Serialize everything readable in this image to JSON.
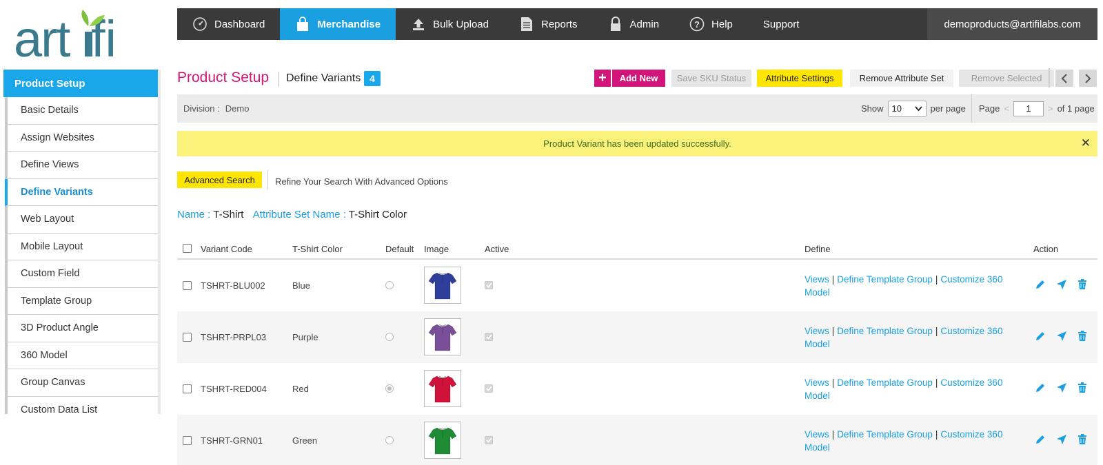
{
  "brand": {
    "logo_text": "artifi",
    "accent": "#1aa7ea",
    "primary_pink": "#d2157a",
    "yellow": "#ffe500"
  },
  "topnav": {
    "items": [
      {
        "label": "Dashboard",
        "icon": "gauge-icon"
      },
      {
        "label": "Merchandise",
        "icon": "shopping-bag-icon",
        "active": true
      },
      {
        "label": "Bulk Upload",
        "icon": "upload-icon"
      },
      {
        "label": "Reports",
        "icon": "document-icon"
      },
      {
        "label": "Admin",
        "icon": "lock-icon"
      },
      {
        "label": "Help",
        "icon": "question-icon"
      },
      {
        "label": "Support",
        "icon": ""
      }
    ],
    "user": "demoproducts@artifilabs.com"
  },
  "sidebar": {
    "header": "Product Setup",
    "items": [
      {
        "label": "Basic Details"
      },
      {
        "label": "Assign Websites"
      },
      {
        "label": "Define Views"
      },
      {
        "label": "Define Variants",
        "active": true
      },
      {
        "label": "Web Layout"
      },
      {
        "label": "Mobile Layout"
      },
      {
        "label": "Custom Field"
      },
      {
        "label": "Template Group"
      },
      {
        "label": "3D Product Angle"
      },
      {
        "label": "360 Model"
      },
      {
        "label": "Group Canvas"
      },
      {
        "label": "Custom Data List"
      }
    ]
  },
  "header": {
    "title": "Product Setup",
    "subtitle": "Define Variants",
    "count": "4",
    "buttons": {
      "add_new": "Add New",
      "save_sku": "Save SKU Status",
      "attr_settings": "Attribute Settings",
      "remove_set": "Remove Attribute Set",
      "remove_selected": "Remove Selected"
    }
  },
  "divbar": {
    "division_label": "Division :",
    "division_value": "Demo",
    "show_label": "Show",
    "per_page_value": "10",
    "per_page_label": "per page",
    "page_label": "Page",
    "page_value": "1",
    "page_total": "of 1 page"
  },
  "alert": {
    "message": "Product Variant has been updated successfully."
  },
  "search": {
    "advanced_label": "Advanced Search",
    "hint": "Refine Your Search With Advanced Options"
  },
  "info": {
    "name_key": "Name :",
    "name_value": "T-Shirt",
    "attr_key": "Attribute Set Name :",
    "attr_value": "T-Shirt Color"
  },
  "table": {
    "headers": {
      "code": "Variant Code",
      "color": "T-Shirt Color",
      "default": "Default",
      "image": "Image",
      "active": "Active",
      "define": "Define",
      "action": "Action"
    },
    "define_links": {
      "views": "Views",
      "template_group": "Define Template Group",
      "customize": "Customize 360 Model"
    },
    "rows": [
      {
        "code": "TSHRT-BLU002",
        "color": "Blue",
        "default": false,
        "swatch": "#2f3e9a"
      },
      {
        "code": "TSHRT-PRPL03",
        "color": "Purple",
        "default": false,
        "swatch": "#7a4f9a"
      },
      {
        "code": "TSHRT-RED004",
        "color": "Red",
        "default": true,
        "swatch": "#d0123a"
      },
      {
        "code": "TSHRT-GRN01",
        "color": "Green",
        "default": false,
        "swatch": "#1e8c35"
      }
    ]
  }
}
